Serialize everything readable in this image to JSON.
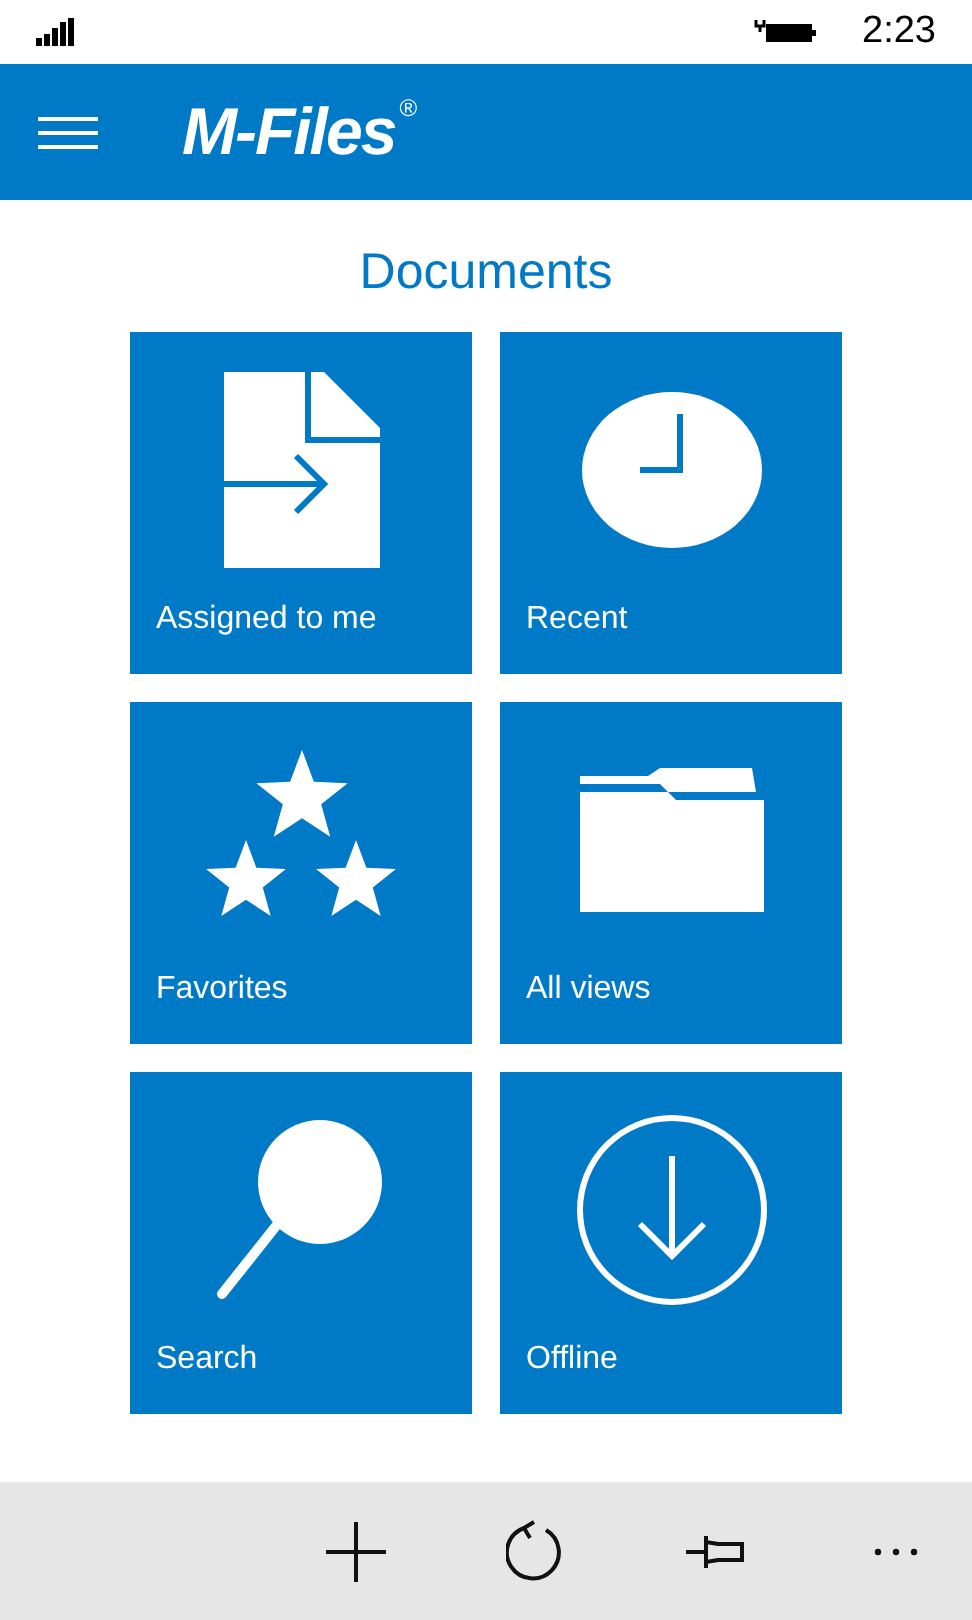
{
  "status_bar": {
    "time": "2:23"
  },
  "header": {
    "logo": "M-Files",
    "logo_mark": "®"
  },
  "title": "Documents",
  "tiles": [
    {
      "kind": "assigned",
      "label": "Assigned to me"
    },
    {
      "kind": "recent",
      "label": "Recent"
    },
    {
      "kind": "favorites",
      "label": "Favorites"
    },
    {
      "kind": "views",
      "label": "All views"
    },
    {
      "kind": "search",
      "label": "Search"
    },
    {
      "kind": "offline",
      "label": "Offline"
    }
  ],
  "app_bar": [
    {
      "kind": "add"
    },
    {
      "kind": "refresh"
    },
    {
      "kind": "pin"
    },
    {
      "kind": "more"
    }
  ]
}
